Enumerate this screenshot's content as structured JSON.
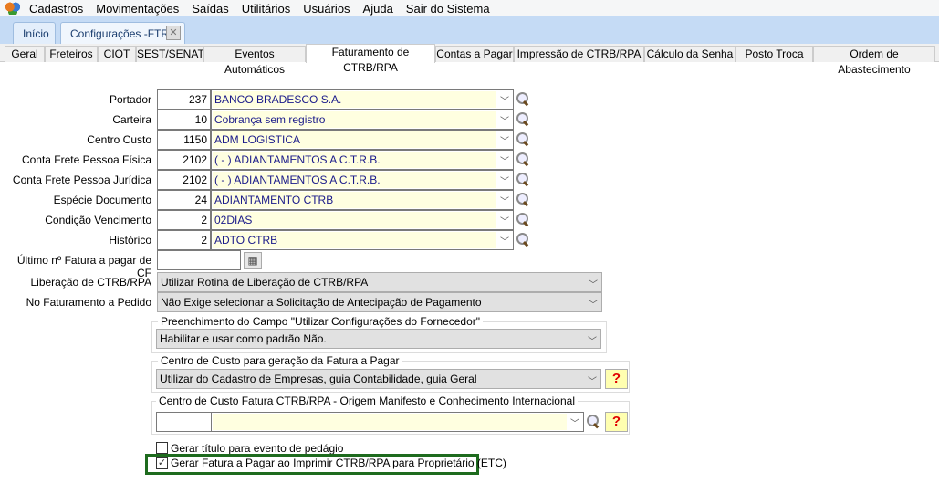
{
  "menu": [
    "Cadastros",
    "Movimentações",
    "Saídas",
    "Utilitários",
    "Usuários",
    "Ajuda",
    "Sair do Sistema"
  ],
  "main_tabs": [
    "Início",
    "Configurações -FTR"
  ],
  "sub_tabs": [
    "Geral",
    "Freteiros",
    "CIOT",
    "SEST/SENAT",
    "Eventos Automáticos",
    "Faturamento de CTRB/RPA",
    "Contas a Pagar",
    "Impressão de CTRB/RPA",
    "Cálculo da Senha",
    "Posto Troca",
    "Ordem de Abastecimento"
  ],
  "active_sub_tab": "Faturamento de CTRB/RPA",
  "lookup_rows": [
    {
      "label": "Portador",
      "code": "237",
      "desc": "BANCO BRADESCO S.A."
    },
    {
      "label": "Carteira",
      "code": "10",
      "desc": "Cobrança sem registro"
    },
    {
      "label": "Centro Custo",
      "code": "1150",
      "desc": "ADM LOGISTICA"
    },
    {
      "label": "Conta Frete Pessoa Física",
      "code": "2102",
      "desc": "( - ) ADIANTAMENTOS A C.T.R.B."
    },
    {
      "label": "Conta Frete Pessoa Jurídica",
      "code": "2102",
      "desc": "( - ) ADIANTAMENTOS A C.T.R.B."
    },
    {
      "label": "Espécie Documento",
      "code": "24",
      "desc": "ADIANTAMENTO CTRB"
    },
    {
      "label": "Condição Vencimento",
      "code": "2",
      "desc": "02DIAS"
    },
    {
      "label": "Histórico",
      "code": "2",
      "desc": "ADTO CTRB"
    }
  ],
  "ultimo": {
    "label": "Último nº Fatura a pagar de CF",
    "value": ""
  },
  "liberacao": {
    "label": "Liberação de CTRB/RPA",
    "value": "Utilizar Rotina de Liberação de CTRB/RPA"
  },
  "no_faturamento": {
    "label": "No Faturamento a Pedido",
    "value": "Não Exige selecionar a Solicitação de Antecipação de Pagamento"
  },
  "group1": {
    "legend": "Preenchimento do Campo \"Utilizar Configurações do Fornecedor\"",
    "value": "Habilitar e usar como padrão Não."
  },
  "group2": {
    "legend": "Centro de Custo para geração da Fatura a Pagar",
    "value": "Utilizar do Cadastro de Empresas, guia Contabilidade, guia Geral",
    "help": "?"
  },
  "group3": {
    "legend": "Centro de Custo Fatura CTRB/RPA - Origem Manifesto e Conhecimento Internacional",
    "code": "",
    "desc": "",
    "help": "?"
  },
  "checkboxes": [
    {
      "label": "Gerar título para evento de pedágio",
      "checked": false
    },
    {
      "label": "Gerar Fatura a Pagar ao Imprimir CTRB/RPA para Proprietário (ETC)",
      "checked": true
    }
  ],
  "colors": {
    "highlight": "#1e6b1e",
    "tabstrip": "#c5dbf5",
    "field_yellow": "#ffffe0"
  }
}
